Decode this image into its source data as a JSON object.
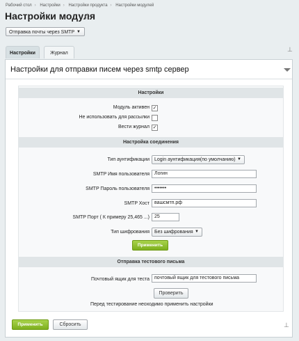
{
  "breadcrumbs": [
    "Рабочий стол",
    "Настройки",
    "Настройки продукта",
    "Настройки модулей"
  ],
  "page_title": "Настройки модуля",
  "module_select": {
    "value": "Отправка почты через SMTP"
  },
  "tabs": [
    {
      "label": "Настройки",
      "active": true
    },
    {
      "label": "Журнал",
      "active": false
    }
  ],
  "panel": {
    "title": "Настройки для отправки писем через smtp сервер"
  },
  "sections": {
    "settings": {
      "title": "Настройки",
      "rows": [
        {
          "label": "Модуль активен",
          "checked": true
        },
        {
          "label": "Не использовать для рассылки",
          "checked": false
        },
        {
          "label": "Вести журнал",
          "checked": true
        }
      ]
    },
    "connection": {
      "title": "Настройка соединения",
      "auth_type": {
        "label": "Тип аунтификации",
        "value": "Login аунтификация(по умолчанию)"
      },
      "user": {
        "label": "SMTP Имя пользователя",
        "value": "Логин"
      },
      "password": {
        "label": "SMTP Пароль пользователя",
        "value": "•••••••"
      },
      "host": {
        "label": "SMTP Хост",
        "value": "вашсмтп.рф"
      },
      "port": {
        "label": "SMTP Порт ( К примеру 25,465 ...)",
        "value": "25"
      },
      "encryption": {
        "label": "Тип шифрования",
        "value": "Без шифрования"
      },
      "apply_label": "Применить"
    },
    "test": {
      "title": "Отправка тестового письма",
      "email": {
        "label": "Почтовый ящик для теста",
        "value": "почтовый ящик для тестового письма"
      },
      "check_label": "Проверить",
      "note": "Перед тестирование неоходимо применить настройки"
    }
  },
  "footer": {
    "apply_label": "Применить",
    "reset_label": "Сбросить"
  },
  "colors": {
    "accent_green": "#8cc033",
    "section_header": "#e0e5e7",
    "background": "#e9eef0"
  }
}
